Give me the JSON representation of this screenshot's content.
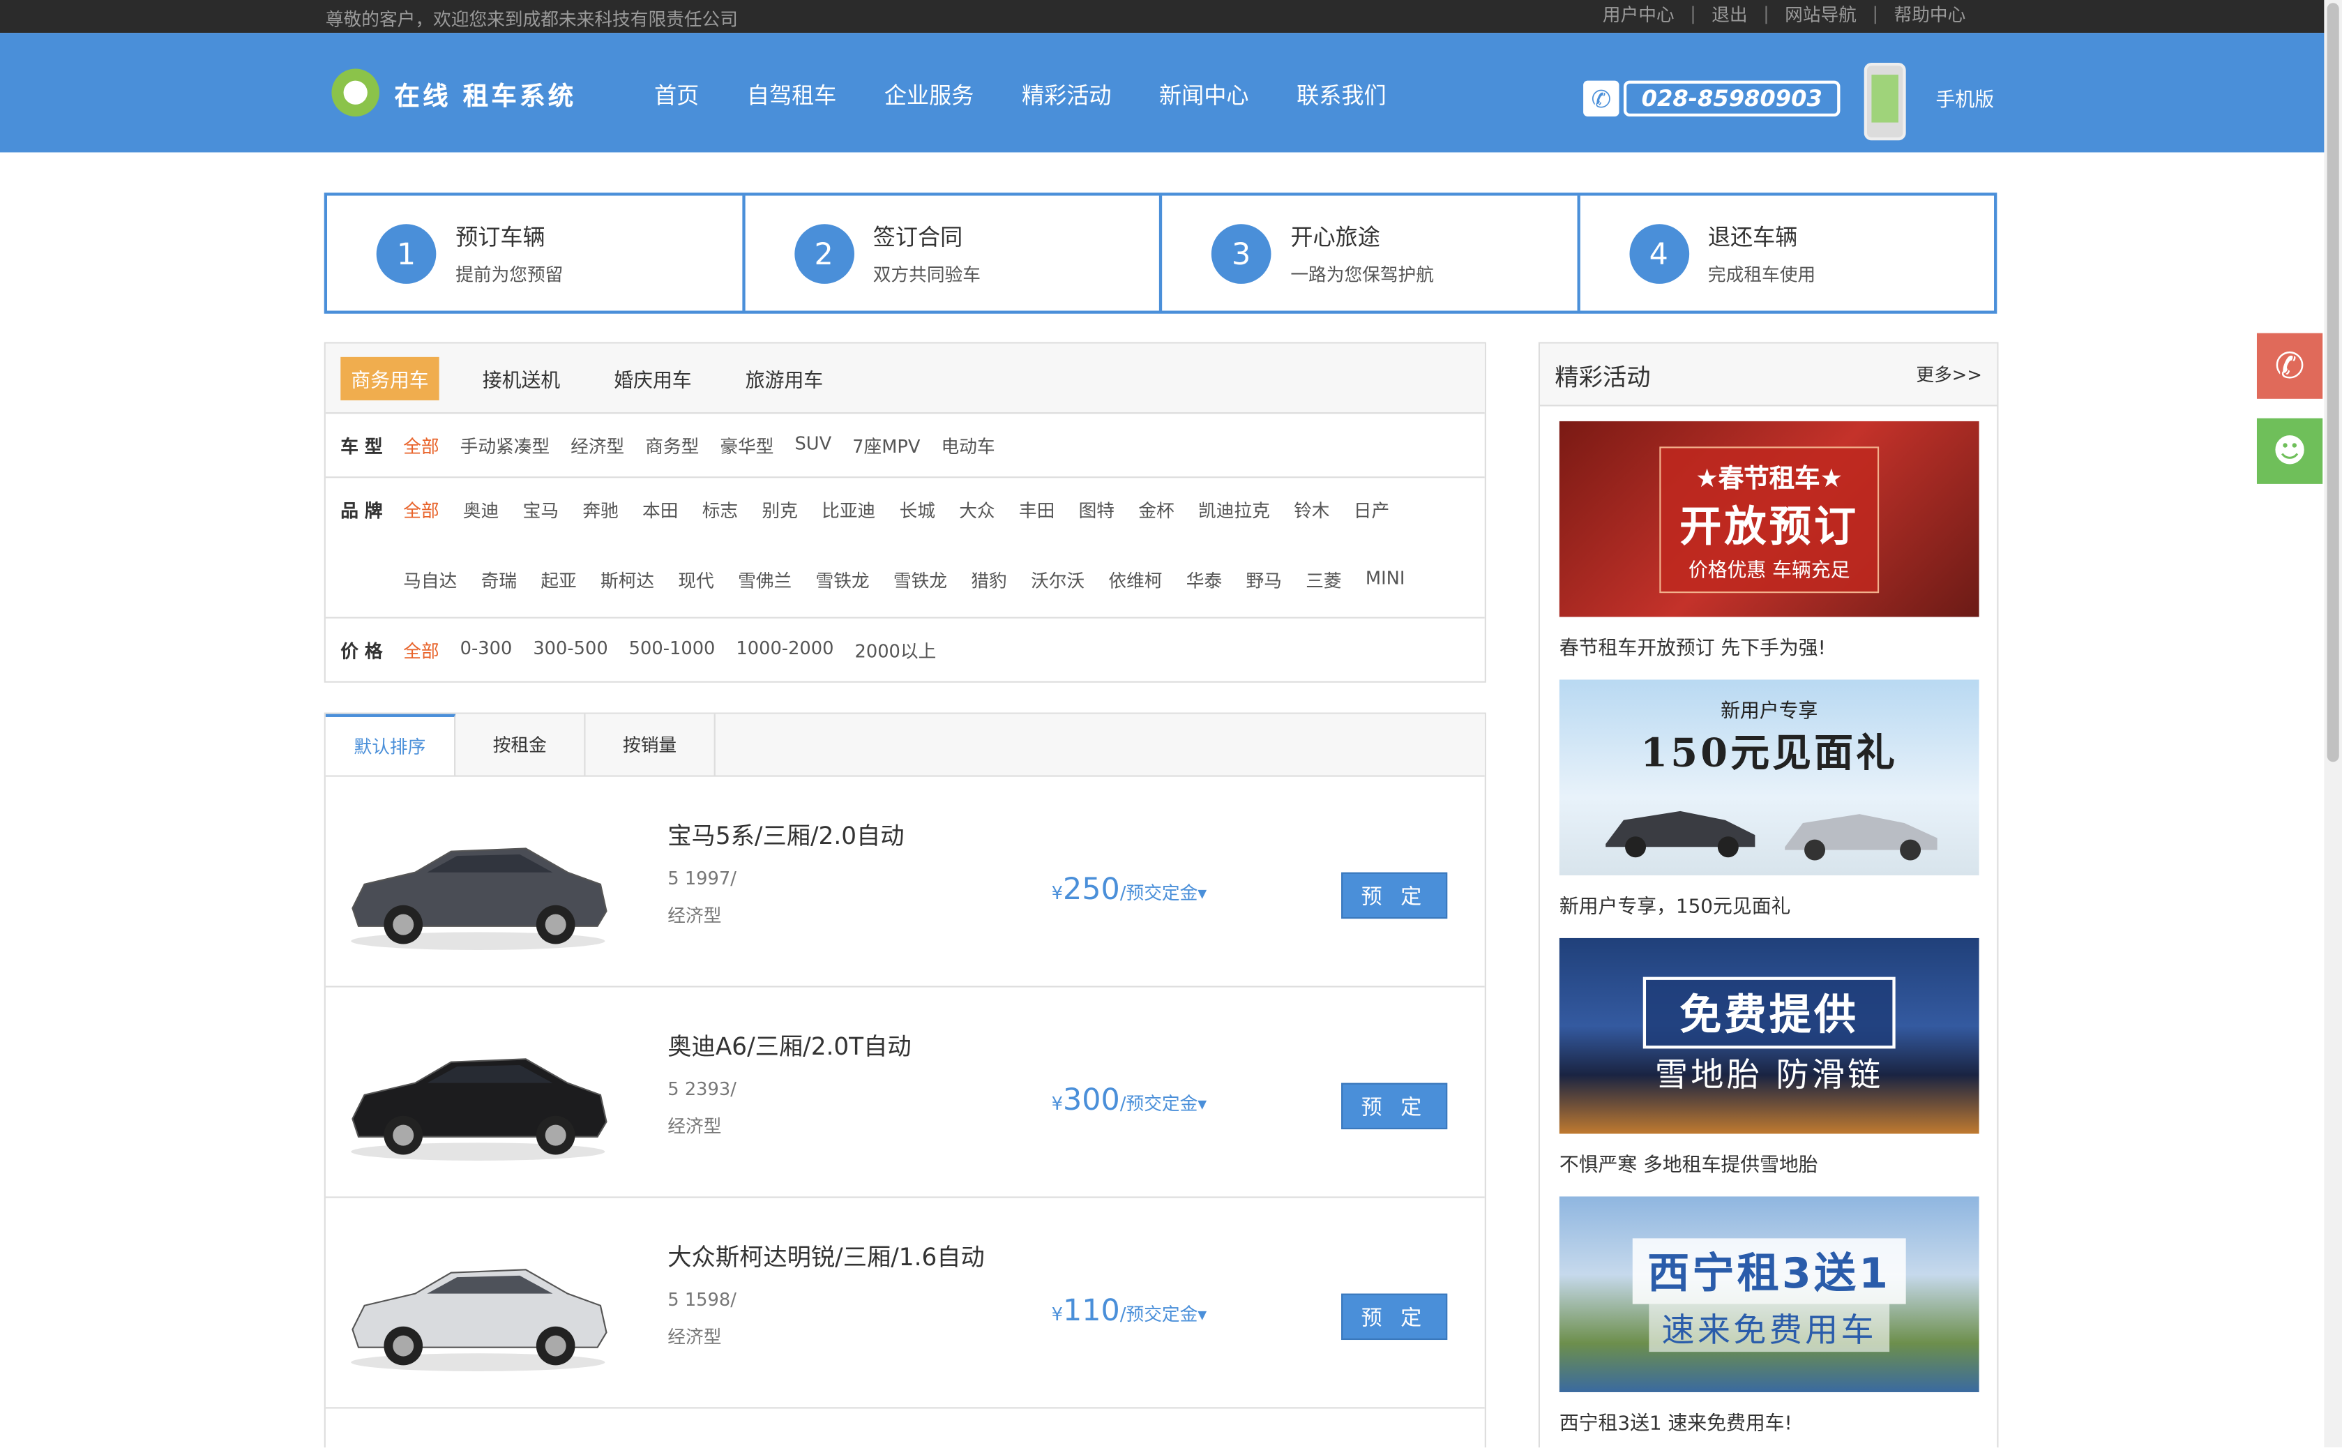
{
  "topbar": {
    "welcome": "尊敬的客户，欢迎您来到成都未来科技有限责任公司",
    "links": [
      "用户中心",
      "退出",
      "网站导航",
      "帮助中心"
    ]
  },
  "header": {
    "logo_text": "在线 租车系统",
    "nav": [
      "首页",
      "自驾租车",
      "企业服务",
      "精彩活动",
      "新闻中心",
      "联系我们"
    ],
    "phone": "028-85980903",
    "mobile_label": "手机版"
  },
  "steps": [
    {
      "num": "1",
      "title": "预订车辆",
      "sub": "提前为您预留"
    },
    {
      "num": "2",
      "title": "签订合同",
      "sub": "双方共同验车"
    },
    {
      "num": "3",
      "title": "开心旅途",
      "sub": "一路为您保驾护航"
    },
    {
      "num": "4",
      "title": "退还车辆",
      "sub": "完成租车使用"
    }
  ],
  "filter": {
    "tabs": [
      "商务用车",
      "接机送机",
      "婚庆用车",
      "旅游用车"
    ],
    "type_label": "车 型",
    "types": [
      "全部",
      "手动紧凑型",
      "经济型",
      "商务型",
      "豪华型",
      "SUV",
      "7座MPV",
      "电动车"
    ],
    "brand_label": "品 牌",
    "brands": [
      "全部",
      "奥迪",
      "宝马",
      "奔驰",
      "本田",
      "标志",
      "别克",
      "比亚迪",
      "长城",
      "大众",
      "丰田",
      "图特",
      "金杯",
      "凯迪拉克",
      "铃木",
      "日产",
      "马自达",
      "奇瑞",
      "起亚",
      "斯柯达",
      "现代",
      "雪佛兰",
      "雪铁龙",
      "雪铁龙",
      "猎豹",
      "沃尔沃",
      "依维柯",
      "华泰",
      "野马",
      "三菱",
      "MINI"
    ],
    "price_label": "价 格",
    "prices": [
      "全部",
      "0-300",
      "300-500",
      "500-1000",
      "1000-2000",
      "2000以上"
    ]
  },
  "list": {
    "sort_tabs": [
      "默认排序",
      "按租金",
      "按销量"
    ],
    "cars": [
      {
        "name": "宝马5系/三厢/2.0自动",
        "spec": "5 1997/",
        "class": "经济型",
        "price": "250",
        "currency": "¥",
        "unit": "/预交定金▾",
        "button": "预 定",
        "color": "#4a4d55"
      },
      {
        "name": "奥迪A6/三厢/2.0T自动",
        "spec": "5 2393/",
        "class": "经济型",
        "price": "300",
        "currency": "¥",
        "unit": "/预交定金▾",
        "button": "预 定",
        "color": "#1c1c1e"
      },
      {
        "name": "大众斯柯达明锐/三厢/1.6自动",
        "spec": "5 1598/",
        "class": "经济型",
        "price": "110",
        "currency": "¥",
        "unit": "/预交定金▾",
        "button": "预 定",
        "color": "#d9dbde"
      }
    ]
  },
  "promo": {
    "title": "精彩活动",
    "more": "更多>>",
    "items": [
      {
        "caption": "春节租车开放预订 先下手为强!",
        "line1": "★春节租车★",
        "line2": "开放预订",
        "line3": "价格优惠 车辆充足"
      },
      {
        "caption": "新用户专享，150元见面礼",
        "line1": "新用户专享",
        "line2": "150元见面礼",
        "line3": ""
      },
      {
        "caption": "不惧严寒 多地租车提供雪地胎",
        "line1": "",
        "line2": "免费提供",
        "line3": "雪地胎 防滑链"
      },
      {
        "caption": "西宁租3送1 速来免费用车!",
        "line1": "",
        "line2": "西宁租3送1",
        "line3": "速来免费用车"
      }
    ]
  },
  "colors": {
    "primary": "#4a8fd9",
    "accent": "#f0ad4e",
    "active_filter": "#e8632a",
    "phone_float": "#e06a5a",
    "qq_float": "#6fbf5a"
  }
}
